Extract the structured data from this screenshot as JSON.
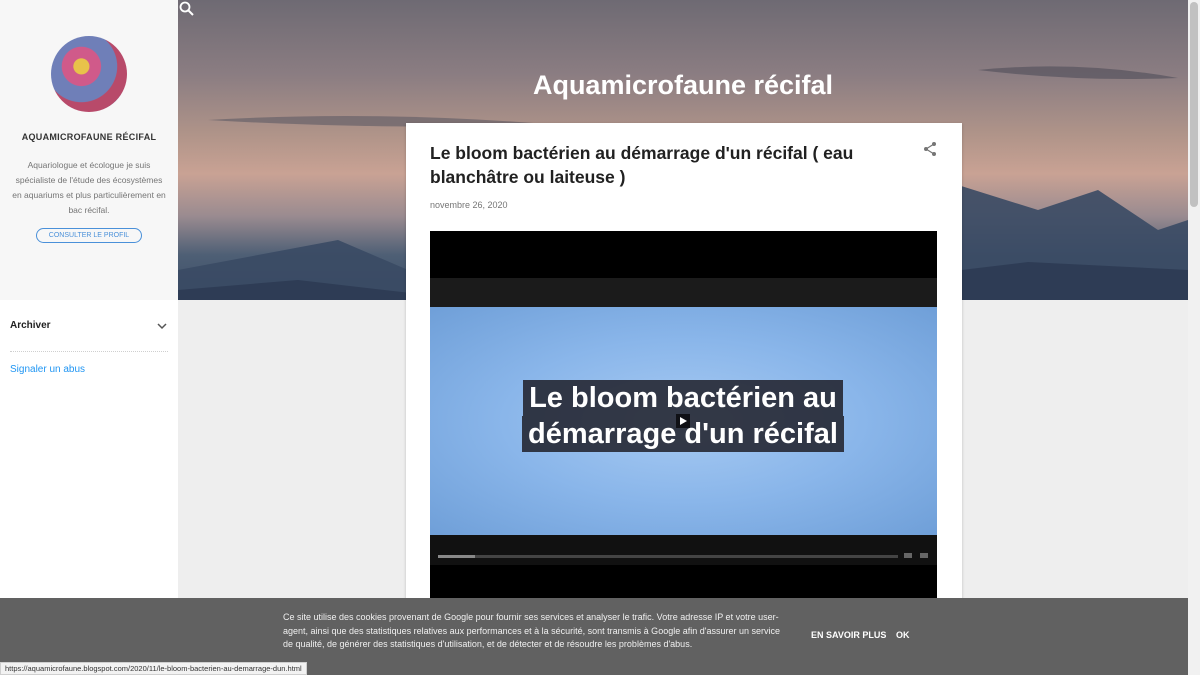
{
  "header": {
    "title": "Aquamicrofaune récifal",
    "search_icon": "search-icon"
  },
  "sidebar": {
    "profile_name": "AQUAMICROFAUNE RÉCIFAL",
    "profile_desc": "Aquariologue et écologue je suis spécialiste de l'étude des écosystèmes en aquariums et plus particulièrement en bac récifal.",
    "profile_button": "CONSULTER LE PROFIL",
    "archive_label": "Archiver",
    "report_link": "Signaler un abus"
  },
  "post": {
    "title": "Le bloom bactérien au démarrage d'un récifal ( eau blanchâtre ou laiteuse )",
    "date": "novembre 26, 2020",
    "share_icon": "share-icon",
    "video": {
      "caption_line1": "Le bloom bactérien au",
      "caption_line2": "démarrage d'un récifal"
    }
  },
  "cookie": {
    "text": "Ce site utilise des cookies provenant de Google pour fournir ses services et analyser le trafic. Votre adresse IP et votre user-agent, ainsi que des statistiques relatives aux performances et à la sécurité, sont transmis à Google afin d'assurer un service de qualité, de générer des statistiques d'utilisation, et de détecter et de résoudre les problèmes d'abus.",
    "more_label": "EN SAVOIR PLUS",
    "ok_label": "OK"
  },
  "status_bar": {
    "url": "https://aquamicrofaune.blogspot.com/2020/11/le-bloom-bacterien-au-demarrage-dun.html"
  }
}
